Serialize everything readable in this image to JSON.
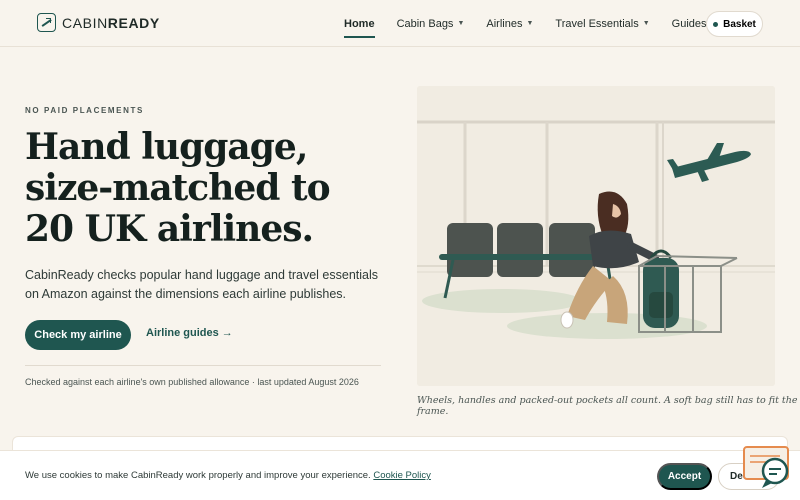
{
  "brand": {
    "name_light": "CABIN",
    "name_bold": "READY"
  },
  "nav": {
    "items": [
      {
        "label": "Home",
        "dropdown": false,
        "active": true
      },
      {
        "label": "Cabin Bags",
        "dropdown": true
      },
      {
        "label": "Airlines",
        "dropdown": true
      },
      {
        "label": "Travel Essentials",
        "dropdown": true
      },
      {
        "label": "Guides",
        "dropdown": true
      }
    ],
    "basket_label": "Basket"
  },
  "hero": {
    "eyebrow": "NO PAID PLACEMENTS",
    "headline": "Hand luggage, size-matched to 20 UK airlines.",
    "lede": "CabinReady checks popular hand luggage and travel essentials on Amazon against the dimensions each airline publishes.",
    "primary_cta": "Check my airline",
    "secondary_cta": "Airline guides →",
    "footnote": "Checked against each airline's own published allowance · last updated August 2026",
    "caption": "Wheels, handles and packed-out pockets all count. A soft bag still has to fit the frame."
  },
  "cookie": {
    "text": "We use cookies to make CabinReady work properly and improve your experience.",
    "link": "Cookie Policy",
    "accept": "Accept",
    "decline": "Decline"
  },
  "colors": {
    "accent": "#1f5650",
    "background": "#f8f4ed"
  },
  "icons": {
    "caret": "chevron-down-icon",
    "logo": "logo-icon",
    "chat": "chat-widget-icon"
  }
}
